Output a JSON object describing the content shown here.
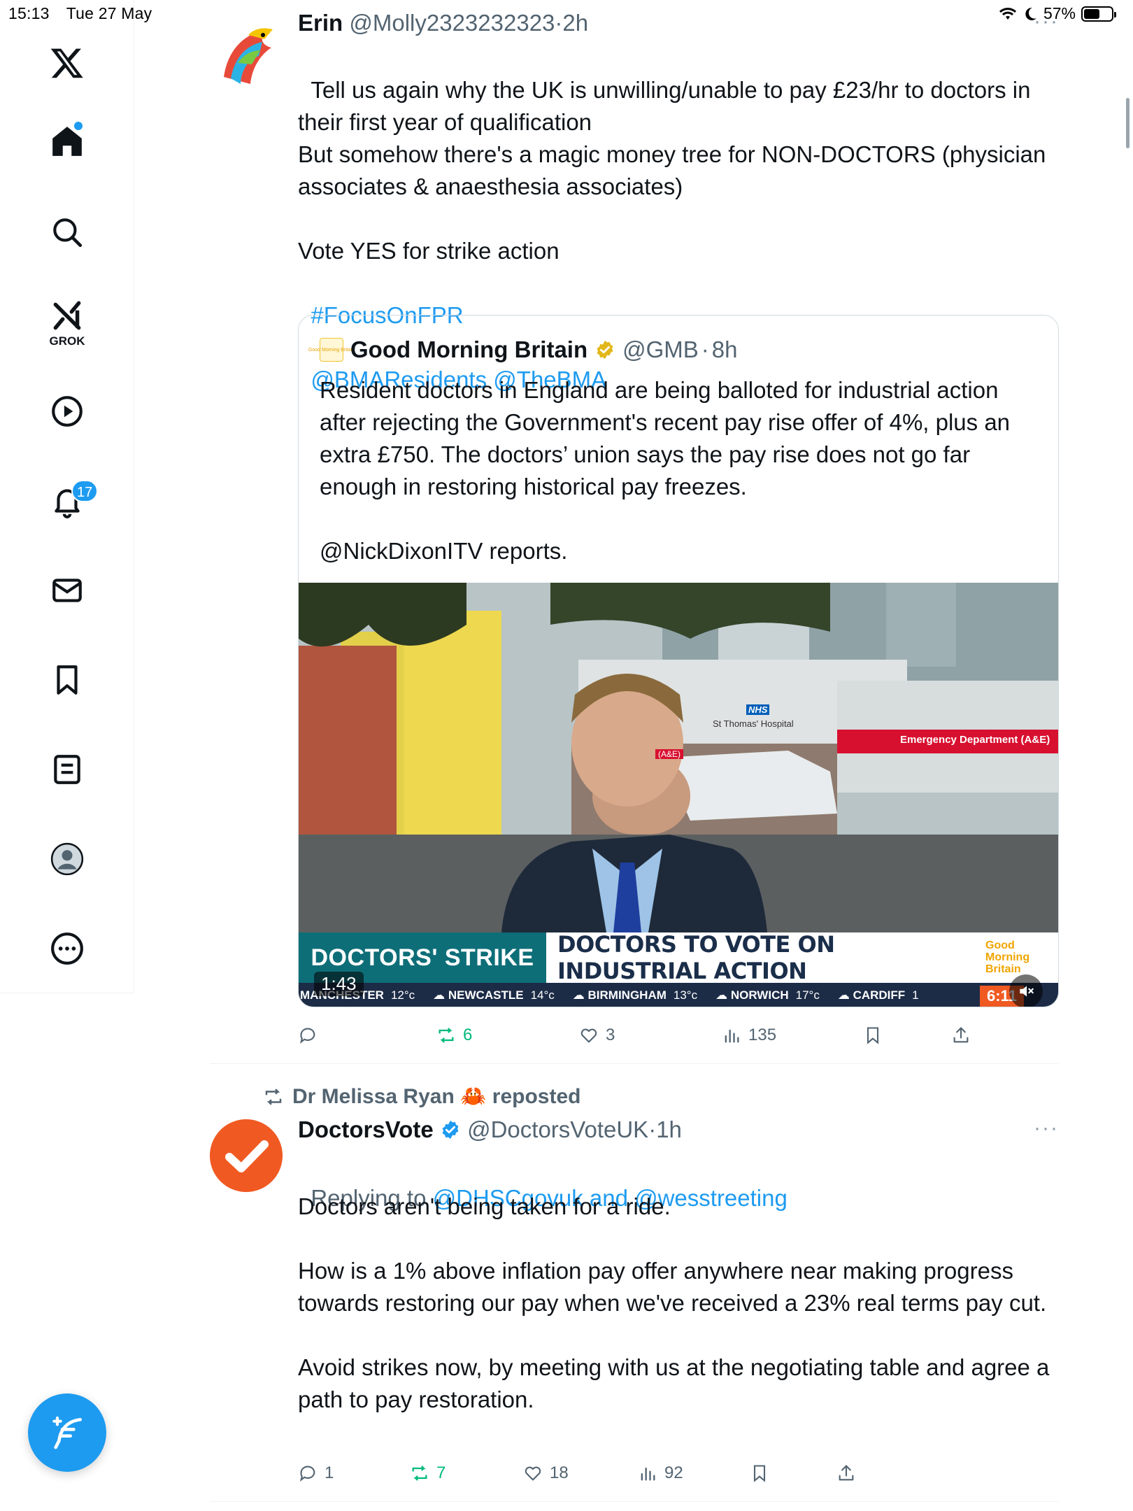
{
  "status_bar": {
    "time": "15:13",
    "date": "Tue 27 May",
    "battery": "57%",
    "battery_level": 0.57
  },
  "sidebar": {
    "grok_label": "GROK",
    "notifications_count": "17"
  },
  "tweet1": {
    "name": "Erin",
    "handle": "@Molly2323232323",
    "dot": "·",
    "time": "2h",
    "text": "Tell us again why the UK is unwilling/unable to pay £23/hr to doctors in their first year of qualification\nBut somehow there's a magic money tree for NON-DOCTORS (physician associates & anaesthesia associates)\n\nVote YES for strike action",
    "hashtag": "#FocusOnFPR",
    "mention1": "@BMAResidents",
    "mention2": "@TheBMA",
    "quote": {
      "logo_text": "Good Morning Britain",
      "name": "Good Morning Britain",
      "handle": "@GMB",
      "dot": "·",
      "time": "8h",
      "text": "Resident doctors in England are being balloted for industrial action after rejecting the Government's recent pay rise offer of 4%, plus an extra £750. The doctors’ union says the pay rise does not go far enough in restoring historical pay freezes.\n\n@NickDixonITV reports.",
      "video": {
        "nhs_label": "NHS",
        "hospital": "St Thomas' Hospital",
        "ae_label": "(A&E)",
        "emergency_sign": "Emergency Department (A&E)",
        "ticker_left": "DOCTORS' STRIKE",
        "ticker_right": "DOCTORS TO VOTE ON INDUSTRIAL ACTION",
        "ticker_logo": "Good Morning Britain",
        "weather": [
          {
            "city": "MANCHESTER",
            "temp": "12°c"
          },
          {
            "city": "NEWCASTLE",
            "temp": "14°c"
          },
          {
            "city": "BIRMINGHAM",
            "temp": "13°c"
          },
          {
            "city": "NORWICH",
            "temp": "17°c"
          },
          {
            "city": "CARDIFF",
            "temp": "1"
          }
        ],
        "clock": "6:11",
        "duration": "1:43"
      }
    },
    "actions": {
      "replies": "",
      "reposts": "6",
      "likes": "3",
      "views": "135"
    }
  },
  "tweet2": {
    "reposted_by": "Dr Melissa Ryan 🦀 reposted",
    "name": "DoctorsVote",
    "handle": "@DoctorsVoteUK",
    "dot": "·",
    "time": "1h",
    "replying_prefix": "Replying to",
    "replying_to": "@DHSCgovuk and @wesstreeting",
    "text": "Doctors aren't being taken for a ride.\n\nHow is a 1% above inflation pay offer anywhere near making progress towards restoring our pay when we've received a 23% real terms pay cut.\n\nAvoid strikes now, by meeting with us at the negotiating table and agree a path to pay restoration.",
    "actions": {
      "replies": "1",
      "reposts": "7",
      "likes": "18",
      "views": "92"
    }
  },
  "colors": {
    "accent": "#1d9bf0",
    "repost_green": "#00ba7c",
    "text_secondary": "#536471",
    "doctorsvote_orange": "#f05a22"
  }
}
